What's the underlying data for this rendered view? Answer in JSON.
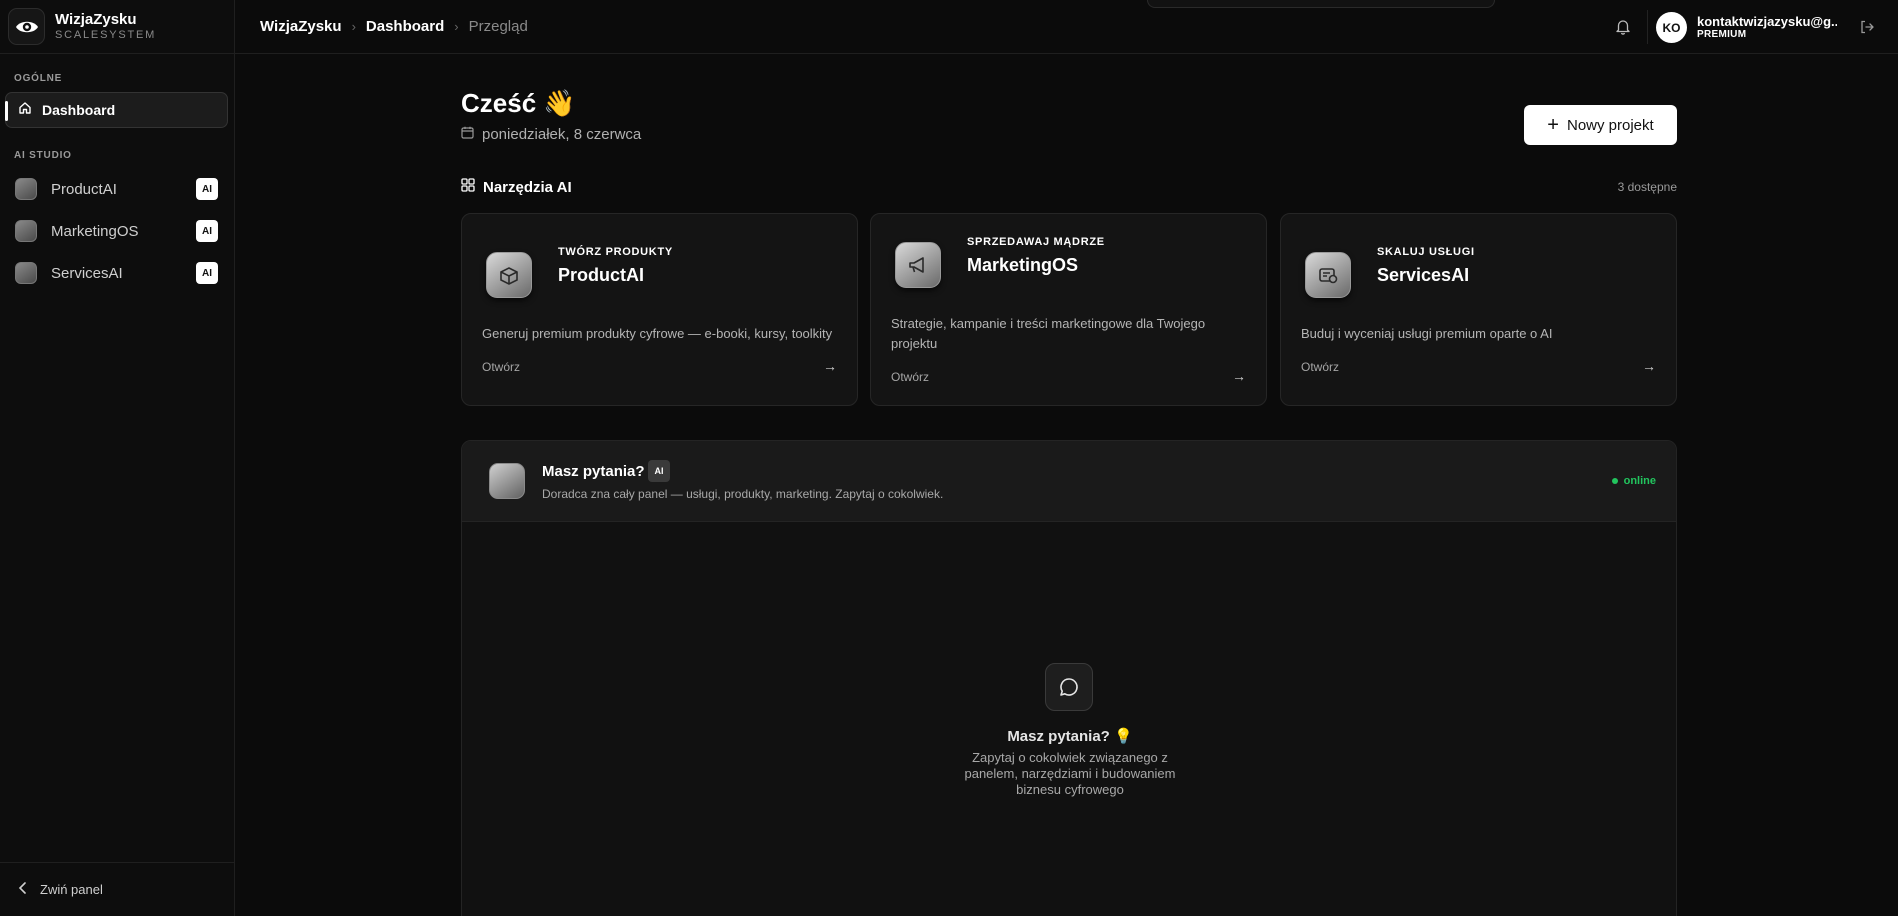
{
  "sidebar": {
    "brand_name": "WizjaZysku",
    "brand_sub": "SCALESYSTEM",
    "section_general": "OGÓLNE",
    "dashboard_label": "Dashboard",
    "section_ai": "AI STUDIO",
    "items": [
      {
        "label": "ProductAI",
        "badge": "AI"
      },
      {
        "label": "MarketingOS",
        "badge": "AI"
      },
      {
        "label": "ServicesAI",
        "badge": "AI"
      }
    ],
    "collapse_label": "Zwiń panel"
  },
  "topbar": {
    "breadcrumb": [
      "WizjaZysku",
      "Dashboard",
      "Przegląd"
    ],
    "avatar_initials": "KO",
    "user_email": "kontaktwizjazysku@g...",
    "user_plan": "PREMIUM"
  },
  "main": {
    "greeting": "Cześć 👋",
    "date": "poniedziałek, 8 czerwca",
    "new_project_label": "Nowy projekt",
    "tools_title": "Narzędzia AI",
    "tools_count": "3 dostępne",
    "cards": [
      {
        "kicker": "TWÓRZ PRODUKTY",
        "title": "ProductAI",
        "desc": "Generuj premium produkty cyfrowe — e-booki, kursy, toolkity",
        "open": "Otwórz",
        "icon": "product-box-icon"
      },
      {
        "kicker": "SPRZEDAWAJ MĄDRZE",
        "title": "MarketingOS",
        "desc": "Strategie, kampanie i treści marketingowe dla Twojego projektu",
        "open": "Otwórz",
        "icon": "megaphone-icon"
      },
      {
        "kicker": "SKALUJ USŁUGI",
        "title": "ServicesAI",
        "desc": "Buduj i wyceniaj usługi premium oparte o AI",
        "open": "Otwórz",
        "icon": "services-gear-icon"
      }
    ]
  },
  "chat": {
    "title": "Masz pytania?",
    "badge": "AI",
    "subtitle": "Doradca zna cały panel — usługi, produkty, marketing. Zapytaj o cokolwiek.",
    "status": "online",
    "empty_title": "Masz pytania? 💡",
    "empty_desc": "Zapytaj o cokolwiek związanego z panelem, narzędziami i budowaniem biznesu cyfrowego"
  },
  "colors": {
    "background": "#0b0b0b",
    "card": "#141414",
    "accent_online": "#22c55e"
  }
}
